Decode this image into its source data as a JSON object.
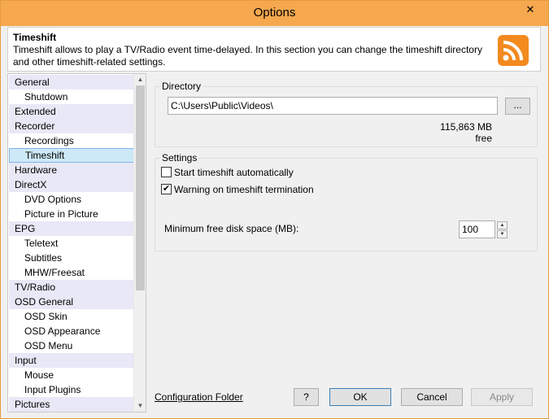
{
  "window": {
    "title": "Options",
    "close_glyph": "✕"
  },
  "banner": {
    "title": "Timeshift",
    "description": "Timeshift allows to play a TV/Radio event time-delayed. In this section you can change the timeshift directory and other timeshift-related settings."
  },
  "tree": {
    "items": [
      {
        "label": "General",
        "level": 0
      },
      {
        "label": "Shutdown",
        "level": 1
      },
      {
        "label": "Extended",
        "level": 0
      },
      {
        "label": "Recorder",
        "level": 0
      },
      {
        "label": "Recordings",
        "level": 1
      },
      {
        "label": "Timeshift",
        "level": 1,
        "selected": true
      },
      {
        "label": "Hardware",
        "level": 0
      },
      {
        "label": "DirectX",
        "level": 0
      },
      {
        "label": "DVD Options",
        "level": 1
      },
      {
        "label": "Picture in Picture",
        "level": 1
      },
      {
        "label": "EPG",
        "level": 0
      },
      {
        "label": "Teletext",
        "level": 1
      },
      {
        "label": "Subtitles",
        "level": 1
      },
      {
        "label": "MHW/Freesat",
        "level": 1
      },
      {
        "label": "TV/Radio",
        "level": 0
      },
      {
        "label": "OSD General",
        "level": 0
      },
      {
        "label": "OSD Skin",
        "level": 1
      },
      {
        "label": "OSD Appearance",
        "level": 1
      },
      {
        "label": "OSD Menu",
        "level": 1
      },
      {
        "label": "Input",
        "level": 0
      },
      {
        "label": "Mouse",
        "level": 1
      },
      {
        "label": "Input Plugins",
        "level": 1
      },
      {
        "label": "Pictures",
        "level": 0
      }
    ]
  },
  "directory": {
    "legend": "Directory",
    "path": "C:\\Users\\Public\\Videos\\",
    "browse_label": "...",
    "free_space": "115,863 MB free"
  },
  "settings": {
    "legend": "Settings",
    "start_auto": {
      "label": "Start timeshift automatically",
      "checked": false
    },
    "warning": {
      "label": "Warning on timeshift termination",
      "checked": true
    },
    "min_free_label": "Minimum free disk space (MB):",
    "min_free_value": "100"
  },
  "footer": {
    "config_link": "Configuration Folder",
    "help_label": "?",
    "ok_label": "OK",
    "cancel_label": "Cancel",
    "apply_label": "Apply"
  }
}
